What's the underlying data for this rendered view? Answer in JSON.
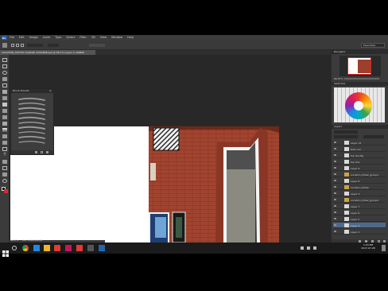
{
  "menu": {
    "app_logo": "Ps",
    "items": [
      "File",
      "Edit",
      "Image",
      "Layer",
      "Type",
      "Select",
      "Filter",
      "3D",
      "View",
      "Window",
      "Help"
    ]
  },
  "options_bar": {
    "workspace": "Essentials"
  },
  "document": {
    "tab_title": "LOCATION_TATTOO GARAGE COVIDINE.psd @ 66.7% (Layer 4, RGB/8)"
  },
  "brush_panel": {
    "title": "Brush Presets"
  },
  "panels": {
    "navigator": "Navigator",
    "swatches": "Swatches",
    "layers": "Layers",
    "zoom": "66.67%"
  },
  "layers": [
    "Layer 13",
    "Dark rim",
    "top line Bg",
    "top line",
    "Layer 9",
    "Location_folder_group1",
    "Layer 8",
    "Location_folder",
    "Layer 3",
    "Location_folder_group2",
    "Layer 7",
    "Layer 6",
    "Layer 5",
    "Layer 4",
    "Layer 2"
  ],
  "status": {
    "zoom": "66.67%",
    "doc": "Doc: 4.94M/149.8M"
  },
  "taskbar": {
    "time": "1:23 PM",
    "date": "2017-07-28"
  },
  "colors": {
    "brick": "#9c3f2c",
    "ps_dark": "#535353",
    "windows_blue": "#0078d7"
  }
}
